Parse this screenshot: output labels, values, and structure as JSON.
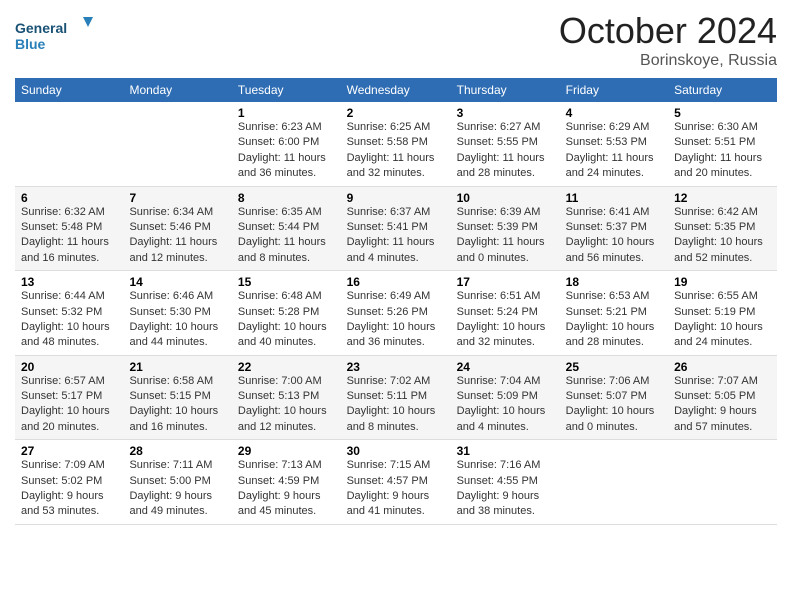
{
  "header": {
    "logo_general": "General",
    "logo_blue": "Blue",
    "month": "October 2024",
    "location": "Borinskoye, Russia"
  },
  "days_of_week": [
    "Sunday",
    "Monday",
    "Tuesday",
    "Wednesday",
    "Thursday",
    "Friday",
    "Saturday"
  ],
  "weeks": [
    [
      {
        "day": "",
        "content": ""
      },
      {
        "day": "",
        "content": ""
      },
      {
        "day": "1",
        "content": "Sunrise: 6:23 AM\nSunset: 6:00 PM\nDaylight: 11 hours and 36 minutes."
      },
      {
        "day": "2",
        "content": "Sunrise: 6:25 AM\nSunset: 5:58 PM\nDaylight: 11 hours and 32 minutes."
      },
      {
        "day": "3",
        "content": "Sunrise: 6:27 AM\nSunset: 5:55 PM\nDaylight: 11 hours and 28 minutes."
      },
      {
        "day": "4",
        "content": "Sunrise: 6:29 AM\nSunset: 5:53 PM\nDaylight: 11 hours and 24 minutes."
      },
      {
        "day": "5",
        "content": "Sunrise: 6:30 AM\nSunset: 5:51 PM\nDaylight: 11 hours and 20 minutes."
      }
    ],
    [
      {
        "day": "6",
        "content": "Sunrise: 6:32 AM\nSunset: 5:48 PM\nDaylight: 11 hours and 16 minutes."
      },
      {
        "day": "7",
        "content": "Sunrise: 6:34 AM\nSunset: 5:46 PM\nDaylight: 11 hours and 12 minutes."
      },
      {
        "day": "8",
        "content": "Sunrise: 6:35 AM\nSunset: 5:44 PM\nDaylight: 11 hours and 8 minutes."
      },
      {
        "day": "9",
        "content": "Sunrise: 6:37 AM\nSunset: 5:41 PM\nDaylight: 11 hours and 4 minutes."
      },
      {
        "day": "10",
        "content": "Sunrise: 6:39 AM\nSunset: 5:39 PM\nDaylight: 11 hours and 0 minutes."
      },
      {
        "day": "11",
        "content": "Sunrise: 6:41 AM\nSunset: 5:37 PM\nDaylight: 10 hours and 56 minutes."
      },
      {
        "day": "12",
        "content": "Sunrise: 6:42 AM\nSunset: 5:35 PM\nDaylight: 10 hours and 52 minutes."
      }
    ],
    [
      {
        "day": "13",
        "content": "Sunrise: 6:44 AM\nSunset: 5:32 PM\nDaylight: 10 hours and 48 minutes."
      },
      {
        "day": "14",
        "content": "Sunrise: 6:46 AM\nSunset: 5:30 PM\nDaylight: 10 hours and 44 minutes."
      },
      {
        "day": "15",
        "content": "Sunrise: 6:48 AM\nSunset: 5:28 PM\nDaylight: 10 hours and 40 minutes."
      },
      {
        "day": "16",
        "content": "Sunrise: 6:49 AM\nSunset: 5:26 PM\nDaylight: 10 hours and 36 minutes."
      },
      {
        "day": "17",
        "content": "Sunrise: 6:51 AM\nSunset: 5:24 PM\nDaylight: 10 hours and 32 minutes."
      },
      {
        "day": "18",
        "content": "Sunrise: 6:53 AM\nSunset: 5:21 PM\nDaylight: 10 hours and 28 minutes."
      },
      {
        "day": "19",
        "content": "Sunrise: 6:55 AM\nSunset: 5:19 PM\nDaylight: 10 hours and 24 minutes."
      }
    ],
    [
      {
        "day": "20",
        "content": "Sunrise: 6:57 AM\nSunset: 5:17 PM\nDaylight: 10 hours and 20 minutes."
      },
      {
        "day": "21",
        "content": "Sunrise: 6:58 AM\nSunset: 5:15 PM\nDaylight: 10 hours and 16 minutes."
      },
      {
        "day": "22",
        "content": "Sunrise: 7:00 AM\nSunset: 5:13 PM\nDaylight: 10 hours and 12 minutes."
      },
      {
        "day": "23",
        "content": "Sunrise: 7:02 AM\nSunset: 5:11 PM\nDaylight: 10 hours and 8 minutes."
      },
      {
        "day": "24",
        "content": "Sunrise: 7:04 AM\nSunset: 5:09 PM\nDaylight: 10 hours and 4 minutes."
      },
      {
        "day": "25",
        "content": "Sunrise: 7:06 AM\nSunset: 5:07 PM\nDaylight: 10 hours and 0 minutes."
      },
      {
        "day": "26",
        "content": "Sunrise: 7:07 AM\nSunset: 5:05 PM\nDaylight: 9 hours and 57 minutes."
      }
    ],
    [
      {
        "day": "27",
        "content": "Sunrise: 7:09 AM\nSunset: 5:02 PM\nDaylight: 9 hours and 53 minutes."
      },
      {
        "day": "28",
        "content": "Sunrise: 7:11 AM\nSunset: 5:00 PM\nDaylight: 9 hours and 49 minutes."
      },
      {
        "day": "29",
        "content": "Sunrise: 7:13 AM\nSunset: 4:59 PM\nDaylight: 9 hours and 45 minutes."
      },
      {
        "day": "30",
        "content": "Sunrise: 7:15 AM\nSunset: 4:57 PM\nDaylight: 9 hours and 41 minutes."
      },
      {
        "day": "31",
        "content": "Sunrise: 7:16 AM\nSunset: 4:55 PM\nDaylight: 9 hours and 38 minutes."
      },
      {
        "day": "",
        "content": ""
      },
      {
        "day": "",
        "content": ""
      }
    ]
  ]
}
